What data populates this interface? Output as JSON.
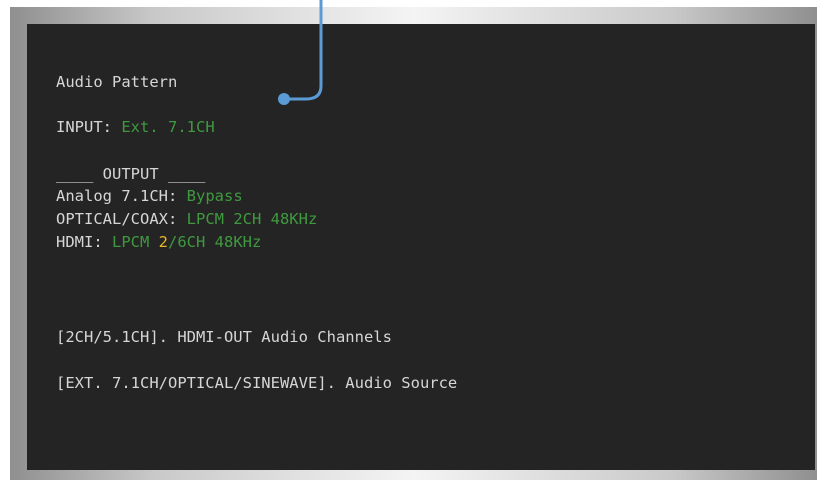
{
  "screen": {
    "title": "Audio Pattern",
    "input": {
      "label": "INPUT: ",
      "value": "Ext. 7.1CH"
    },
    "output_header": "____ OUTPUT ____",
    "outputs": [
      {
        "label": "Analog 7.1CH: ",
        "value": "Bypass"
      },
      {
        "label": "OPTICAL/COAX: ",
        "value": "LPCM 2CH 48KHz"
      },
      {
        "label": "HDMI: ",
        "value_prefix": "LPCM ",
        "value_highlight": "2",
        "value_suffix": "/6CH 48KHz"
      }
    ],
    "key_hints": [
      "[2CH/5.1CH]. HDMI-OUT Audio Channels",
      "[EXT. 7.1CH/OPTICAL/SINEWAVE]. Audio Source"
    ]
  },
  "colors": {
    "text": "#d6d6d6",
    "value_green": "#3f9a3f",
    "highlight_yellow": "#e8b820",
    "screen_bg": "#252424",
    "callout_line": "#5b9bd5"
  }
}
